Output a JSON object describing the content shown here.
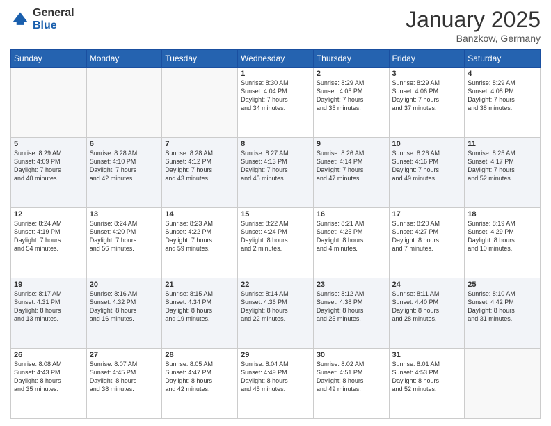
{
  "header": {
    "logo_general": "General",
    "logo_blue": "Blue",
    "month_title": "January 2025",
    "location": "Banzkow, Germany"
  },
  "days_of_week": [
    "Sunday",
    "Monday",
    "Tuesday",
    "Wednesday",
    "Thursday",
    "Friday",
    "Saturday"
  ],
  "weeks": [
    [
      {
        "day": "",
        "info": ""
      },
      {
        "day": "",
        "info": ""
      },
      {
        "day": "",
        "info": ""
      },
      {
        "day": "1",
        "info": "Sunrise: 8:30 AM\nSunset: 4:04 PM\nDaylight: 7 hours\nand 34 minutes."
      },
      {
        "day": "2",
        "info": "Sunrise: 8:29 AM\nSunset: 4:05 PM\nDaylight: 7 hours\nand 35 minutes."
      },
      {
        "day": "3",
        "info": "Sunrise: 8:29 AM\nSunset: 4:06 PM\nDaylight: 7 hours\nand 37 minutes."
      },
      {
        "day": "4",
        "info": "Sunrise: 8:29 AM\nSunset: 4:08 PM\nDaylight: 7 hours\nand 38 minutes."
      }
    ],
    [
      {
        "day": "5",
        "info": "Sunrise: 8:29 AM\nSunset: 4:09 PM\nDaylight: 7 hours\nand 40 minutes."
      },
      {
        "day": "6",
        "info": "Sunrise: 8:28 AM\nSunset: 4:10 PM\nDaylight: 7 hours\nand 42 minutes."
      },
      {
        "day": "7",
        "info": "Sunrise: 8:28 AM\nSunset: 4:12 PM\nDaylight: 7 hours\nand 43 minutes."
      },
      {
        "day": "8",
        "info": "Sunrise: 8:27 AM\nSunset: 4:13 PM\nDaylight: 7 hours\nand 45 minutes."
      },
      {
        "day": "9",
        "info": "Sunrise: 8:26 AM\nSunset: 4:14 PM\nDaylight: 7 hours\nand 47 minutes."
      },
      {
        "day": "10",
        "info": "Sunrise: 8:26 AM\nSunset: 4:16 PM\nDaylight: 7 hours\nand 49 minutes."
      },
      {
        "day": "11",
        "info": "Sunrise: 8:25 AM\nSunset: 4:17 PM\nDaylight: 7 hours\nand 52 minutes."
      }
    ],
    [
      {
        "day": "12",
        "info": "Sunrise: 8:24 AM\nSunset: 4:19 PM\nDaylight: 7 hours\nand 54 minutes."
      },
      {
        "day": "13",
        "info": "Sunrise: 8:24 AM\nSunset: 4:20 PM\nDaylight: 7 hours\nand 56 minutes."
      },
      {
        "day": "14",
        "info": "Sunrise: 8:23 AM\nSunset: 4:22 PM\nDaylight: 7 hours\nand 59 minutes."
      },
      {
        "day": "15",
        "info": "Sunrise: 8:22 AM\nSunset: 4:24 PM\nDaylight: 8 hours\nand 2 minutes."
      },
      {
        "day": "16",
        "info": "Sunrise: 8:21 AM\nSunset: 4:25 PM\nDaylight: 8 hours\nand 4 minutes."
      },
      {
        "day": "17",
        "info": "Sunrise: 8:20 AM\nSunset: 4:27 PM\nDaylight: 8 hours\nand 7 minutes."
      },
      {
        "day": "18",
        "info": "Sunrise: 8:19 AM\nSunset: 4:29 PM\nDaylight: 8 hours\nand 10 minutes."
      }
    ],
    [
      {
        "day": "19",
        "info": "Sunrise: 8:17 AM\nSunset: 4:31 PM\nDaylight: 8 hours\nand 13 minutes."
      },
      {
        "day": "20",
        "info": "Sunrise: 8:16 AM\nSunset: 4:32 PM\nDaylight: 8 hours\nand 16 minutes."
      },
      {
        "day": "21",
        "info": "Sunrise: 8:15 AM\nSunset: 4:34 PM\nDaylight: 8 hours\nand 19 minutes."
      },
      {
        "day": "22",
        "info": "Sunrise: 8:14 AM\nSunset: 4:36 PM\nDaylight: 8 hours\nand 22 minutes."
      },
      {
        "day": "23",
        "info": "Sunrise: 8:12 AM\nSunset: 4:38 PM\nDaylight: 8 hours\nand 25 minutes."
      },
      {
        "day": "24",
        "info": "Sunrise: 8:11 AM\nSunset: 4:40 PM\nDaylight: 8 hours\nand 28 minutes."
      },
      {
        "day": "25",
        "info": "Sunrise: 8:10 AM\nSunset: 4:42 PM\nDaylight: 8 hours\nand 31 minutes."
      }
    ],
    [
      {
        "day": "26",
        "info": "Sunrise: 8:08 AM\nSunset: 4:43 PM\nDaylight: 8 hours\nand 35 minutes."
      },
      {
        "day": "27",
        "info": "Sunrise: 8:07 AM\nSunset: 4:45 PM\nDaylight: 8 hours\nand 38 minutes."
      },
      {
        "day": "28",
        "info": "Sunrise: 8:05 AM\nSunset: 4:47 PM\nDaylight: 8 hours\nand 42 minutes."
      },
      {
        "day": "29",
        "info": "Sunrise: 8:04 AM\nSunset: 4:49 PM\nDaylight: 8 hours\nand 45 minutes."
      },
      {
        "day": "30",
        "info": "Sunrise: 8:02 AM\nSunset: 4:51 PM\nDaylight: 8 hours\nand 49 minutes."
      },
      {
        "day": "31",
        "info": "Sunrise: 8:01 AM\nSunset: 4:53 PM\nDaylight: 8 hours\nand 52 minutes."
      },
      {
        "day": "",
        "info": ""
      }
    ]
  ]
}
